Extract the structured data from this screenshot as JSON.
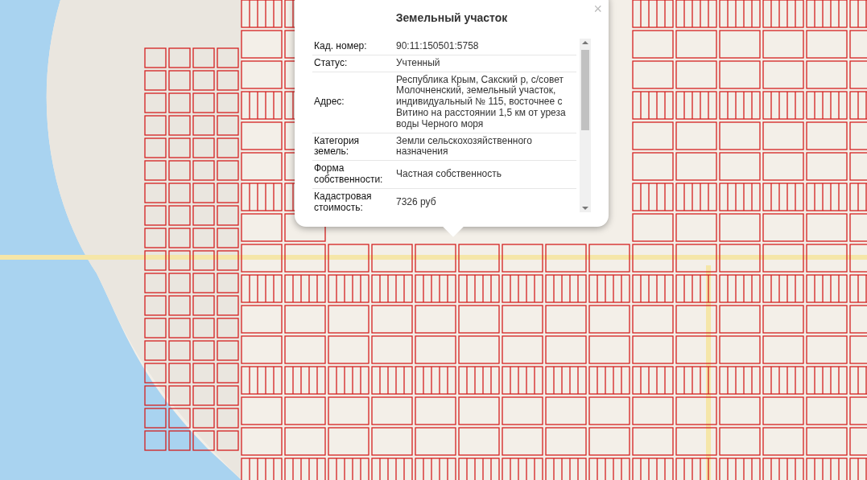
{
  "popup": {
    "title": "Земельный участок",
    "close": "×",
    "rows": [
      {
        "label": "Кад. номер:",
        "value": "90:11:150501:5758"
      },
      {
        "label": "Статус:",
        "value": "Учтенный"
      },
      {
        "label": "Адрес:",
        "value": "Республика Крым, Сакский р, с/совет Молочненский, земельный участок, индивидуальный № 115, восточнее с Витино на расстоянии 1,5 км от уреза воды Черного моря"
      },
      {
        "label": "Категория земель:",
        "value": "Земли сельскохозяйственного назначения"
      },
      {
        "label": "Форма собственности:",
        "value": "Частная собственность"
      },
      {
        "label": "Кадастровая стоимость:",
        "value": "7326 руб"
      }
    ]
  }
}
